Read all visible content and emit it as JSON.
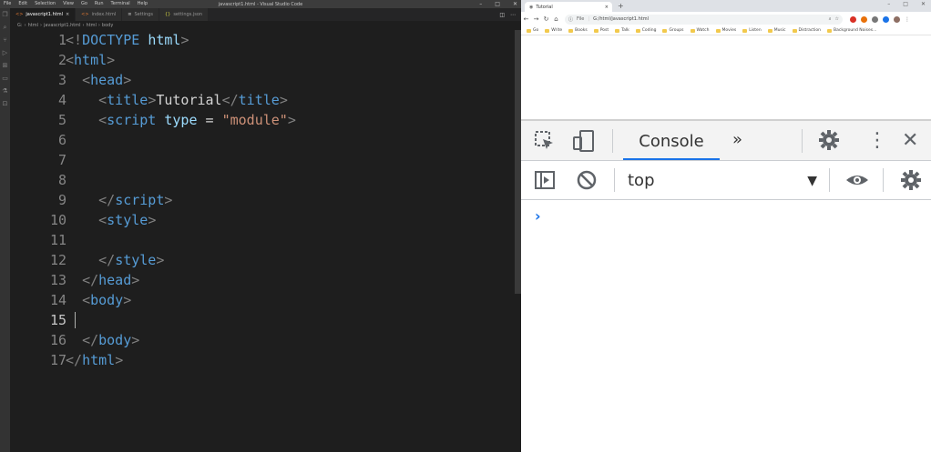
{
  "vscode": {
    "window_title": "javascript1.html - Visual Studio Code",
    "menu": [
      "File",
      "Edit",
      "Selection",
      "View",
      "Go",
      "Run",
      "Terminal",
      "Help"
    ],
    "tabs": [
      {
        "label": "javascript1.html",
        "active": true,
        "close": "×"
      },
      {
        "label": "index.html",
        "active": false
      },
      {
        "label": "Settings",
        "active": false
      },
      {
        "label": "settings.json",
        "active": false
      }
    ],
    "breadcrumb": [
      "G:",
      "html",
      "javascript1.html",
      "html",
      "body"
    ],
    "lines": [
      {
        "n": "1"
      },
      {
        "n": "2"
      },
      {
        "n": "3"
      },
      {
        "n": "4"
      },
      {
        "n": "5"
      },
      {
        "n": "6"
      },
      {
        "n": "7"
      },
      {
        "n": "8"
      },
      {
        "n": "9"
      },
      {
        "n": "10"
      },
      {
        "n": "11"
      },
      {
        "n": "12"
      },
      {
        "n": "13"
      },
      {
        "n": "14"
      },
      {
        "n": "15"
      },
      {
        "n": "16"
      },
      {
        "n": "17"
      }
    ],
    "code": {
      "l1_open": "<!",
      "l1_tag": "DOCTYPE",
      "l1_attr": "html",
      "l1_close": ">",
      "l2_open": "<",
      "l2_tag": "html",
      "l2_close": ">",
      "l3_open": "<",
      "l3_tag": "head",
      "l3_close": ">",
      "l4_open": "<",
      "l4_tag": "title",
      "l4_close": ">",
      "l4_text": "Tutorial",
      "l4_end_open": "</",
      "l4_end_tag": "title",
      "l4_end_close": ">",
      "l5_open": "<",
      "l5_tag": "script",
      "l5_attr": "type",
      "l5_eq": " = ",
      "l5_str": "\"module\"",
      "l5_close": ">",
      "l9_open": "</",
      "l9_tag": "script",
      "l9_close": ">",
      "l10_open": "<",
      "l10_tag": "style",
      "l10_close": ">",
      "l12_open": "</",
      "l12_tag": "style",
      "l12_close": ">",
      "l13_open": "</",
      "l13_tag": "head",
      "l13_close": ">",
      "l14_open": "<",
      "l14_tag": "body",
      "l14_close": ">",
      "l16_open": "</",
      "l16_tag": "body",
      "l16_close": ">",
      "l17_open": "</",
      "l17_tag": "html",
      "l17_close": ">"
    }
  },
  "chrome": {
    "tab_title": "Tutorial",
    "tab_close": "×",
    "new_tab": "+",
    "address_scheme": "File",
    "address": "G:/html/javascript1.html",
    "bookmarks": [
      "Go",
      "Write",
      "Books",
      "Post",
      "Talk",
      "Coding",
      "Groups",
      "Watch",
      "Movies",
      "Listen",
      "Music",
      "Distraction",
      "Background Noises..."
    ],
    "devtools": {
      "console_tab": "Console",
      "more_tabs": "»",
      "context": "top",
      "context_arrow": "▼",
      "prompt": "›"
    }
  },
  "colors": {
    "accent": "#1a73e8",
    "editor_bg": "#1e1e1e",
    "tag": "#569cd6",
    "attr": "#9cdcfe",
    "string": "#ce9178"
  }
}
